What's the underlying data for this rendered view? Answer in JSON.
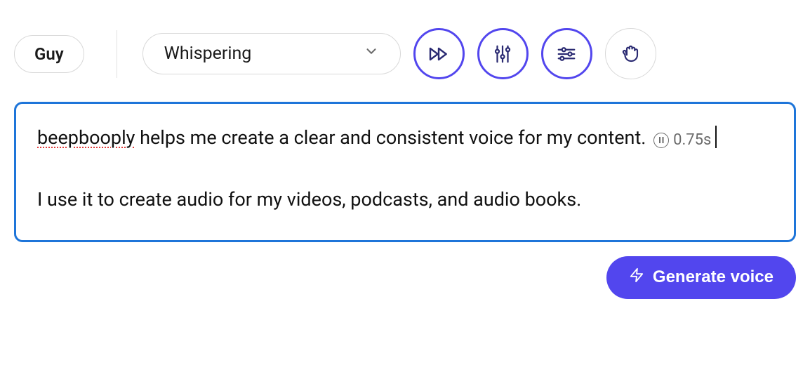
{
  "toolbar": {
    "voice_name": "Guy",
    "style_selected": "Whispering",
    "icons": {
      "speed": "speed-icon",
      "pitch": "pitch-sliders-icon",
      "settings": "settings-sliders-icon",
      "hand": "hand-icon"
    }
  },
  "editor": {
    "p1_word_err": "beepbooply",
    "p1_rest": " helps me create a clear and consistent voice for my content.",
    "pause_label": "0.75s",
    "p2": "I use it to create audio for my videos, podcasts, and audio books."
  },
  "actions": {
    "generate_label": "Generate voice"
  },
  "colors": {
    "accent": "#5246ee",
    "focus_border": "#1e75d9"
  }
}
